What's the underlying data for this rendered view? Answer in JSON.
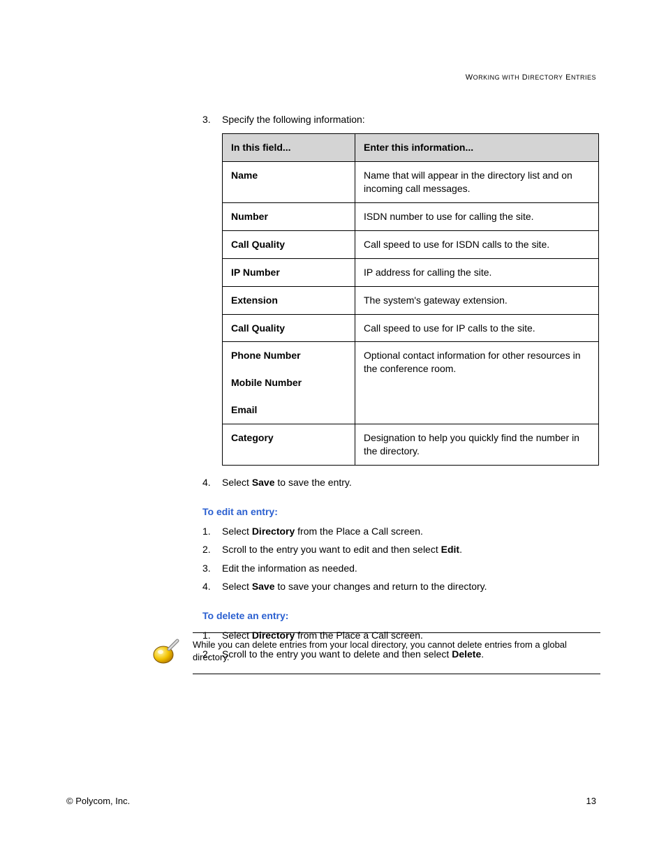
{
  "header": {
    "section_title": "Working with Directory Entries"
  },
  "step3_intro": {
    "num": "3.",
    "text": "Specify the following information:"
  },
  "table": {
    "col1": "In this field...",
    "col2": "Enter this information...",
    "rows": [
      {
        "field": "Name",
        "desc": "Name that will appear in the directory list and on incoming call messages."
      },
      {
        "field": "Number",
        "desc": "ISDN number to use for calling the site."
      },
      {
        "field": "Call Quality",
        "desc": "Call speed to use for ISDN calls to the site."
      },
      {
        "field": "IP Number",
        "desc": "IP address for calling the site."
      },
      {
        "field": "Extension",
        "desc": "The system's gateway extension."
      },
      {
        "field": "Call Quality",
        "desc": "Call speed to use for IP calls to the site."
      },
      {
        "field": "Phone Number",
        "desc": "Optional contact information for other resources in the conference room."
      },
      {
        "field": "Mobile Number",
        "desc": ""
      },
      {
        "field": "Email",
        "desc": ""
      },
      {
        "field": "Category",
        "desc": "Designation to help you quickly find the number in the directory."
      }
    ]
  },
  "step4": {
    "num": "4.",
    "pre": "Select ",
    "bold": "Save",
    "post": " to save the entry."
  },
  "edit": {
    "heading": "To edit an entry:",
    "steps": [
      {
        "num": "1.",
        "pre": "Select ",
        "bold": "Directory",
        "post": " from the Place a Call screen."
      },
      {
        "num": "2.",
        "pre": "Scroll to the entry you want to edit and then select ",
        "bold": "Edit",
        "post": "."
      },
      {
        "num": "3.",
        "pre": "Edit the information as needed.",
        "bold": "",
        "post": ""
      },
      {
        "num": "4.",
        "pre": "Select ",
        "bold": "Save",
        "post": " to save your changes and return to the directory."
      }
    ]
  },
  "del": {
    "heading": "To delete an entry:",
    "steps": [
      {
        "num": "1.",
        "pre": "Select ",
        "bold": "Directory",
        "post": " from the Place a Call screen."
      },
      {
        "num": "2.",
        "pre": "Scroll to the entry you want to delete and then select ",
        "bold": "Delete",
        "post": "."
      }
    ]
  },
  "note": {
    "text": "While you can delete entries from your local directory, you cannot delete entries from a global directory."
  },
  "footer": {
    "copyright": "© Polycom, Inc.",
    "page": "13"
  }
}
